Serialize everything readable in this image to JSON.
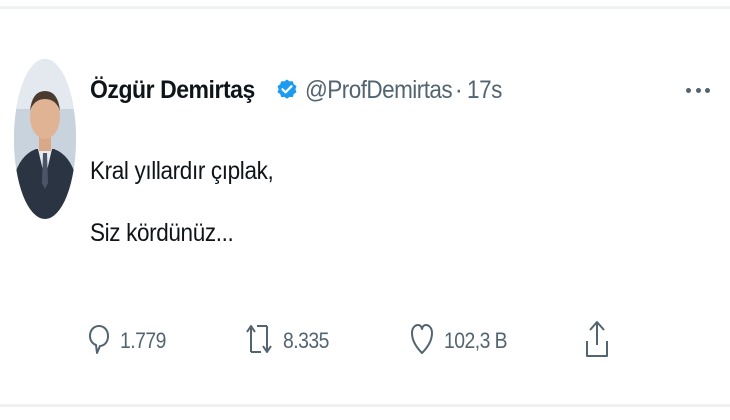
{
  "tweet": {
    "display_name": "Özgür Demirtaş",
    "handle": "@ProfDemirtas",
    "separator": "·",
    "timestamp": "17s",
    "verified_icon": "verified-badge-icon",
    "text_lines": [
      "Kral yıllardır çıplak,",
      "Siz kördünüz..."
    ]
  },
  "actions": {
    "reply_count": "1.779",
    "retweet_count": "8.335",
    "like_count": "102,3 B"
  },
  "icons": {
    "reply": "speech-bubble-icon",
    "retweet": "retweet-arrows-icon",
    "like": "heart-icon",
    "share": "share-upload-icon",
    "more": "more-dots-icon"
  },
  "colors": {
    "verified_blue": "#1d9bf0",
    "text_primary": "#0f1419",
    "text_secondary": "#536471"
  }
}
